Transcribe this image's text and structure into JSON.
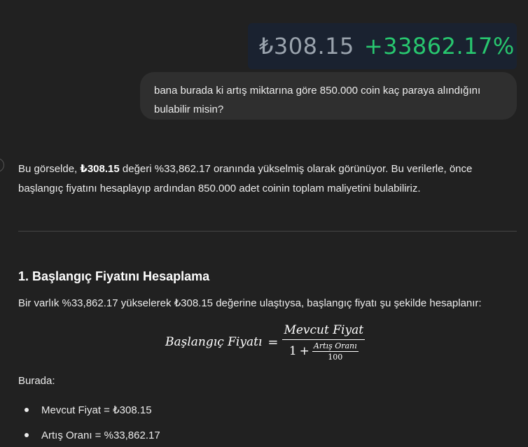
{
  "price_card": {
    "price": "₺308.15",
    "change": "+33862.17%",
    "colors": {
      "background": "#1a2230",
      "price": "#9aa3ad",
      "change": "#28c76f"
    }
  },
  "user_message": {
    "line1": "bana burada ki artış miktarına göre 850.000 coin kaç paraya alındığını",
    "line2": "bulabilir misin?"
  },
  "answer": {
    "intro_pre": "Bu görselde, ",
    "intro_bold": "₺308.15",
    "intro_mid": " değeri %33,862.17 oranında yükselmiş olarak görünüyor. Bu verilerle, önce",
    "intro_line2": "başlangıç fiyatını hesaplayıp ardından 850.000 adet coinin toplam maliyetini bulabiliriz.",
    "section_title": "1. Başlangıç Fiyatını Hesaplama",
    "section_intro": "Bir varlık %33,862.17 yükselerek ₺308.15 değerine ulaştıysa, başlangıç fiyatı şu şekilde hesaplanır:",
    "formula": {
      "lhs": "Başlangıç Fiyatı",
      "eq": "=",
      "numerator": "Mevcut Fiyat",
      "one": "1",
      "plus": "+",
      "inner_numerator": "Artış Oranı",
      "inner_denominator": "100"
    },
    "where_label": "Burada:",
    "bullets": [
      "Mevcut Fiyat = ₺308.15",
      "Artış Oranı = %33,862.17"
    ]
  }
}
